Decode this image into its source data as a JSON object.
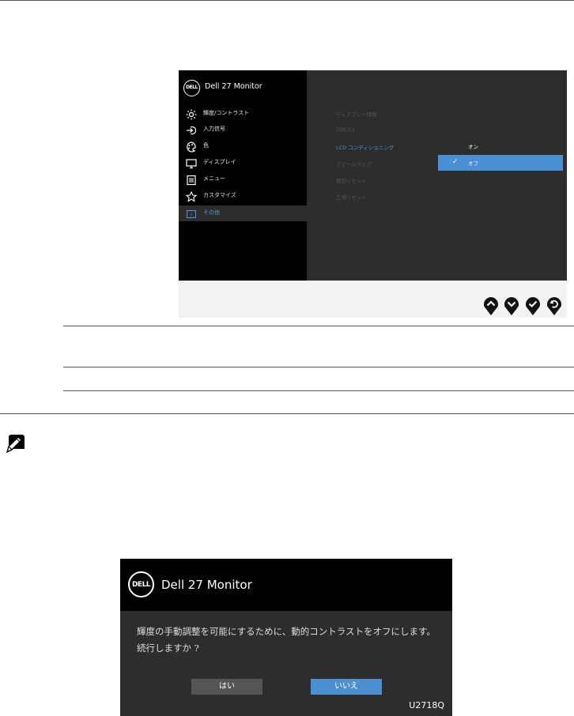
{
  "osd_main": {
    "model": "Dell 27 Monitor",
    "logo_text": "DELL",
    "menu_items": [
      {
        "label": "輝度/コントラスト",
        "icon": "brightness-icon"
      },
      {
        "label": "入力信号",
        "icon": "input-source-icon"
      },
      {
        "label": "色",
        "icon": "color-icon"
      },
      {
        "label": "ディスプレイ",
        "icon": "display-icon"
      },
      {
        "label": "メニュー",
        "icon": "menu-icon"
      },
      {
        "label": "カスタマイズ",
        "icon": "star-icon"
      },
      {
        "label": "その他",
        "icon": "others-icon"
      }
    ],
    "sub_items": [
      {
        "label": "ディスプレー情報"
      },
      {
        "label": "DDC/CI"
      },
      {
        "label": "LCD コンディショニング"
      },
      {
        "label": "ファームウェア"
      },
      {
        "label": "個別リセット"
      },
      {
        "label": "工場リセット"
      }
    ],
    "options": [
      {
        "label": "オン"
      },
      {
        "label": "オフ"
      }
    ]
  },
  "nav_buttons": [
    "up-arrow-icon",
    "down-arrow-icon",
    "check-icon",
    "back-icon"
  ],
  "osd_dialog": {
    "model": "Dell 27 Monitor",
    "logo_text": "DELL",
    "message_line1": "輝度の手動調整を可能にするために、動的コントラストをオフにします。",
    "message_line2": "続行しますか ?",
    "yes_label": "はい",
    "no_label": "いいえ",
    "model_code": "U2718Q"
  },
  "colors": {
    "accent": "#4a90d2",
    "panel_bg": "#2d2d2d",
    "sidebar_bg": "#000000"
  }
}
